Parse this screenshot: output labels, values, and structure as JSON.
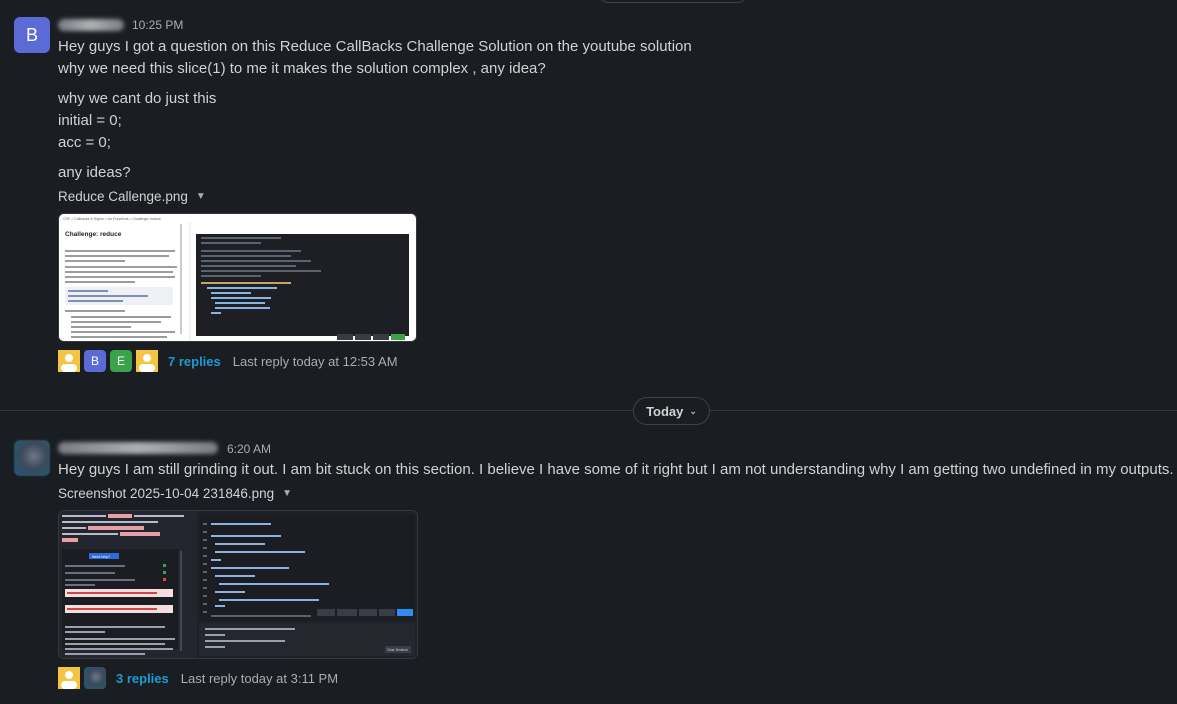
{
  "message1": {
    "avatar_letter": "B",
    "time": "10:25 PM",
    "lines": [
      "Hey guys I got a question on this Reduce CallBacks Challenge Solution on the youtube solution",
      "why we need this slice(1) to me it makes the solution complex , any idea?",
      "why we cant do just this",
      "initial = 0;",
      "acc = 0;",
      "any ideas?"
    ],
    "file_name": "Reduce Callenge.png",
    "replies": "7 replies",
    "last_reply": "Last reply today at 12:53 AM",
    "reply_avatars": [
      "B",
      "E"
    ]
  },
  "divider_label": "Today",
  "message2": {
    "time": "6:20 AM",
    "text": "Hey guys I am still grinding it out. I am bit stuck on this section. I believe I have some of it right but I am not understanding why I am getting two undefined in my outputs.",
    "file_name": "Screenshot 2025-10-04 231846.png",
    "replies": "3 replies",
    "last_reply": "Last reply today at 3:11 PM"
  },
  "thumb1": {
    "breadcrumb": "CDF > Callbacks & Higher > Arr Functions > Challenge: reduce",
    "title": "Challenge: reduce",
    "buttons": [
      "Reset Code",
      "Run Code",
      "Save Code",
      "Run Code"
    ]
  },
  "thumb2": {
    "button": "Need help?",
    "buttons": [
      "Display",
      "Reset Code",
      "Run Code",
      "Save It",
      "Run Code"
    ],
    "terminal_btn": "Clear Terminal"
  },
  "colors": {
    "background": "#1a1d21",
    "link": "#1d9bd1",
    "avatar_b": "#5b6bd5",
    "avatar_e": "#3aa34a",
    "avatar_yellow": "#f4c542"
  }
}
